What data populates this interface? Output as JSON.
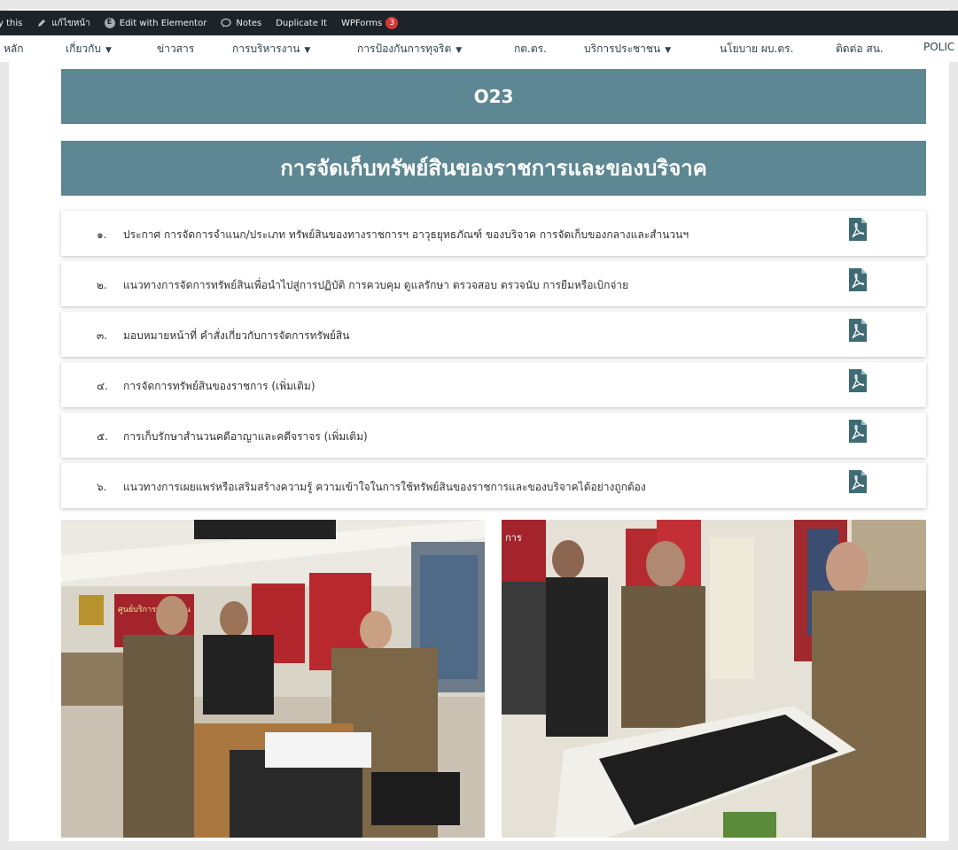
{
  "adminbar": {
    "items": [
      {
        "label": "y this",
        "icon": ""
      },
      {
        "label": "แก้ไขหน้า",
        "icon": "pencil-icon"
      },
      {
        "label": "Edit with Elementor",
        "icon": "elementor-icon"
      },
      {
        "label": "Notes",
        "icon": "comment-icon"
      },
      {
        "label": "Duplicate It",
        "icon": ""
      },
      {
        "label": "WPForms",
        "icon": "",
        "badge": "3"
      }
    ]
  },
  "nav": {
    "items": [
      {
        "label": "หลัก",
        "dropdown": false
      },
      {
        "label": "เกี่ยวกับ",
        "dropdown": true
      },
      {
        "label": "ข่าวสาร",
        "dropdown": false
      },
      {
        "label": "การบริหารงาน",
        "dropdown": true
      },
      {
        "label": "การป้องกันการทุจริต",
        "dropdown": true
      },
      {
        "label": "กต.ตร.",
        "dropdown": false
      },
      {
        "label": "บริการประชาชน",
        "dropdown": true
      },
      {
        "label": "นโยบาย ผบ.ตร.",
        "dropdown": false
      },
      {
        "label": "ติดต่อ สน.",
        "dropdown": false
      },
      {
        "label": "POLIC",
        "dropdown": false
      }
    ]
  },
  "page": {
    "code_title": "O23",
    "main_title": "การจัดเก็บทรัพย์สินของราชการและของบริจาค"
  },
  "documents": [
    {
      "num": "๑.",
      "title": "ประกาศ การจัดการจำแนก/ประเภท ทรัพย์สินของทางราชการฯ อาวุธยุทธภัณฑ์ ของบริจาค การจัดเก็บของกลางและสำนวนฯ"
    },
    {
      "num": "๒.",
      "title": "แนวทางการจัดการทรัพย์สินเพื่อนำไปสู่การปฏิบัติ การควบคุม ดูแลรักษา ตรวจสอบ ตรวจนับ การยืมหรือเบิกจ่าย"
    },
    {
      "num": "๓.",
      "title": "มอบหมายหน้าที่ คำสั่งเกี่ยวกับการจัดการทรัพย์สิน"
    },
    {
      "num": "๔.",
      "title": "การจัดการทรัพย์สินของราชการ (เพิ่มเติม)"
    },
    {
      "num": "๕.",
      "title": "การเก็บรักษาสำนวนคดีอาญาและคดีจราจร (เพิ่มเติม)"
    },
    {
      "num": "๖.",
      "title": "แนวทางการเผยแพร่หรือเสริมสร้างความรู้ ความเข้าใจในการใช้ทรัพย์สินของราชการและของบริจาคได้อย่างถูกต้อง"
    }
  ],
  "photos": {
    "photo1_sign": "ศูนย์บริการประชาชน",
    "photo2_sign": "การ"
  },
  "colors": {
    "banner": "#5d8792",
    "adminbar": "#1d2327",
    "pdf_icon": "#3f6b75"
  }
}
